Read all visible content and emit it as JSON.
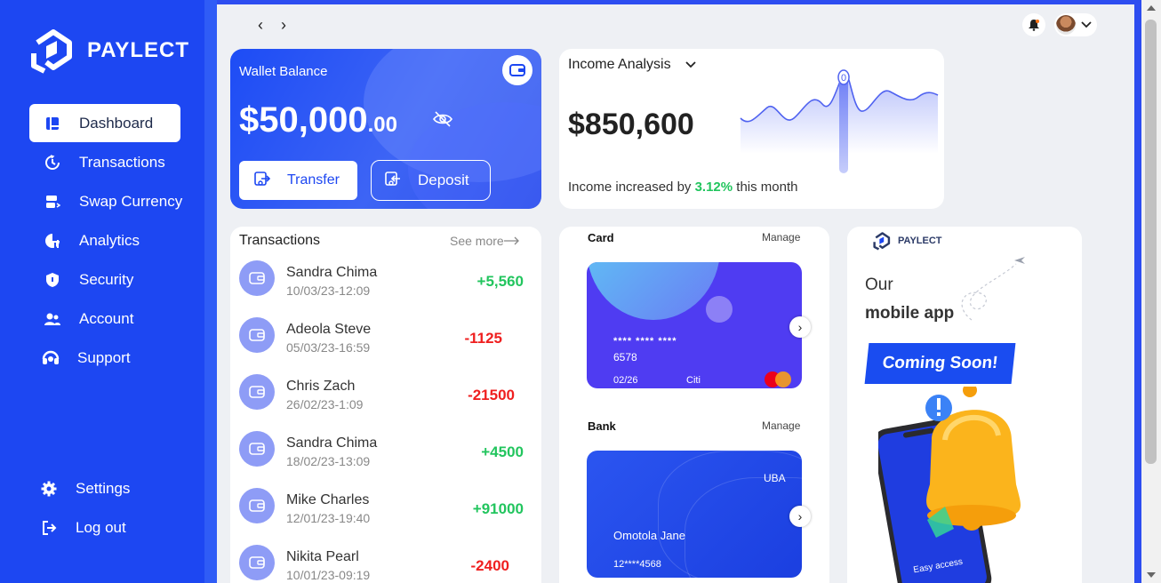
{
  "app": {
    "name": "PAYLECT"
  },
  "nav": {
    "items": [
      {
        "label": "Dashboard",
        "icon": "dashboard-icon",
        "active": true
      },
      {
        "label": "Transactions",
        "icon": "transactions-icon"
      },
      {
        "label": "Swap Currency",
        "icon": "swap-icon"
      },
      {
        "label": "Analytics",
        "icon": "analytics-icon"
      },
      {
        "label": "Security",
        "icon": "shield-icon"
      },
      {
        "label": "Account",
        "icon": "users-icon"
      },
      {
        "label": "Support",
        "icon": "headset-icon"
      }
    ],
    "bottom": [
      {
        "label": "Settings",
        "icon": "gear-icon"
      },
      {
        "label": "Log out",
        "icon": "logout-icon"
      }
    ]
  },
  "wallet": {
    "title": "Wallet Balance",
    "balance_main": "$50,000",
    "balance_cents": ".00",
    "transfer_label": "Transfer",
    "deposit_label": "Deposit"
  },
  "income": {
    "title": "Income Analysis",
    "amount": "$850,600",
    "note_prefix": "Income increased by ",
    "note_pct": "3.12%",
    "note_suffix": " this month",
    "peak_label": "0"
  },
  "transactions": {
    "title": "Transactions",
    "see_more": "See more",
    "rows": [
      {
        "name": "Sandra Chima",
        "date": "10/03/23-12:09",
        "amount": "+5,560",
        "positive": true
      },
      {
        "name": "Adeola Steve",
        "date": "05/03/23-16:59",
        "amount": "-1125",
        "positive": false
      },
      {
        "name": "Chris Zach",
        "date": "26/02/23-1:09",
        "amount": "-21500",
        "positive": false
      },
      {
        "name": "Sandra Chima",
        "date": "18/02/23-13:09",
        "amount": "+4500",
        "positive": true
      },
      {
        "name": "Mike Charles",
        "date": "12/01/23-19:40",
        "amount": "+91000",
        "positive": true
      },
      {
        "name": "Nikita Pearl",
        "date": "10/01/23-09:19",
        "amount": "-2400",
        "positive": false
      }
    ]
  },
  "cards": {
    "card_label": "Card",
    "card_manage": "Manage",
    "card_number_masked": "**** **** ****",
    "card_number_last": "6578",
    "card_expiry": "02/26",
    "card_bank": "Citi",
    "bank_label": "Bank",
    "bank_manage": "Manage",
    "bank_name": "UBA",
    "bank_holder": "Omotola Jane",
    "bank_number": "12****4568"
  },
  "promo": {
    "brand": "PAYLECT",
    "line1": "Our",
    "line2": "mobile app",
    "badge": "Coming Soon!",
    "phone_caption": "Easy access"
  },
  "colors": {
    "primary": "#1d47f2",
    "positive": "#22c55e",
    "negative": "#ef1f1f"
  }
}
